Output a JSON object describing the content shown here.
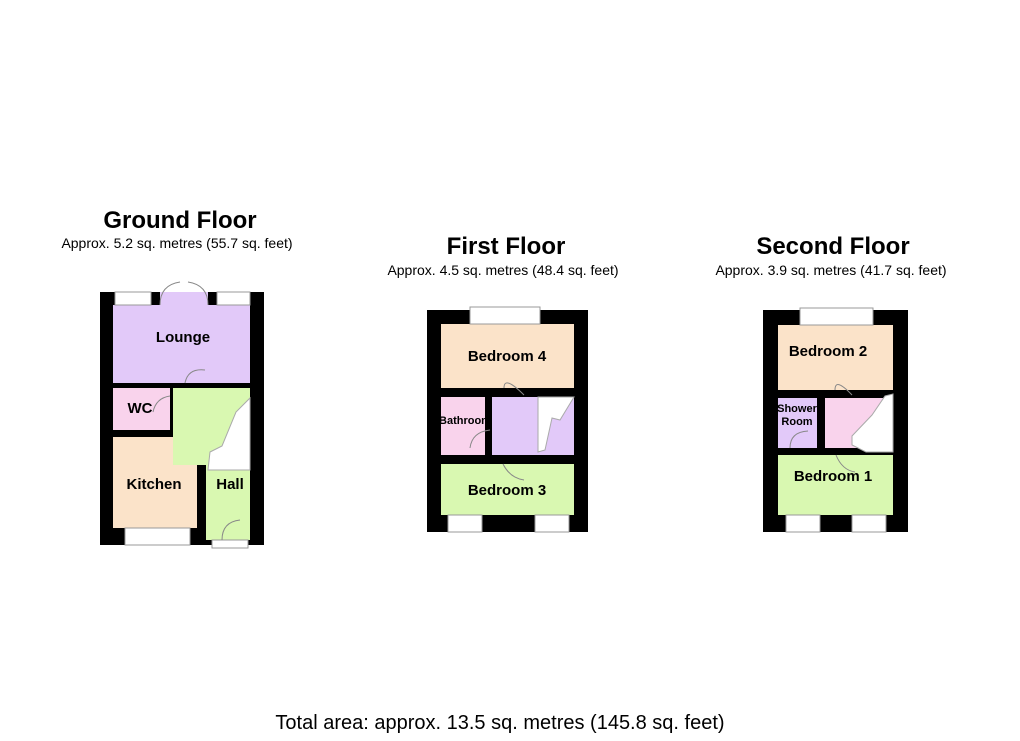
{
  "colors": {
    "lounge": "#e2c9f9",
    "wc": "#f9d3ec",
    "kitchen": "#fbe3c9",
    "hall": "#d9f8b1",
    "bedroom4": "#fbe3c9",
    "bathroom": "#f9d3ec",
    "landing1": "#e2c9f9",
    "bedroom3": "#d9f8b1",
    "bedroom2": "#fbe3c9",
    "shower": "#e2c9f9",
    "landing2": "#f9d3ec",
    "bedroom1": "#d9f8b1",
    "wall": "#000000"
  },
  "ground": {
    "title": "Ground Floor",
    "area": "Approx. 5.2 sq. metres (55.7 sq. feet)",
    "rooms": {
      "lounge": "Lounge",
      "wc": "WC",
      "kitchen": "Kitchen",
      "hall": "Hall"
    }
  },
  "first": {
    "title": "First Floor",
    "area": "Approx. 4.5 sq. metres (48.4 sq. feet)",
    "rooms": {
      "bedroom4": "Bedroom 4",
      "bathroom": "Bathroom",
      "bedroom3": "Bedroom 3"
    }
  },
  "second": {
    "title": "Second Floor",
    "area": "Approx. 3.9 sq. metres (41.7 sq. feet)",
    "rooms": {
      "bedroom2": "Bedroom 2",
      "shower1": "Shower",
      "shower2": "Room",
      "bedroom1": "Bedroom 1"
    }
  },
  "total": "Total area: approx. 13.5 sq. metres (145.8 sq. feet)"
}
